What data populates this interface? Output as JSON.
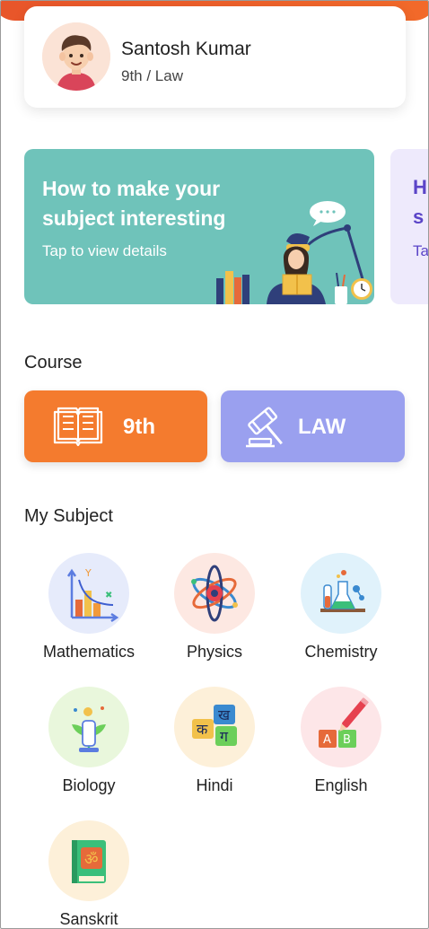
{
  "profile": {
    "name": "Santosh Kumar",
    "class_stream": "9th / Law"
  },
  "banner": {
    "title": "How to make your subject interesting",
    "cta": "Tap to view details",
    "next_peek_lines": [
      "H",
      "s",
      "Ta"
    ]
  },
  "course": {
    "section_title": "Course",
    "items": [
      {
        "label": "9th",
        "icon": "book-icon",
        "color": "#f47b2e"
      },
      {
        "label": "LAW",
        "icon": "gavel-icon",
        "color": "#9aa0ef"
      }
    ]
  },
  "subjects": {
    "section_title": "My Subject",
    "items": [
      {
        "label": "Mathematics",
        "icon": "graph-icon",
        "bg": "#e6ebfb"
      },
      {
        "label": "Physics",
        "icon": "atom-icon",
        "bg": "#fde8e2"
      },
      {
        "label": "Chemistry",
        "icon": "lab-flask-icon",
        "bg": "#e0f2fb"
      },
      {
        "label": "Biology",
        "icon": "plant-microscope-icon",
        "bg": "#e9f7dc"
      },
      {
        "label": "Hindi",
        "icon": "hindi-letters-icon",
        "bg": "#fdf0d9"
      },
      {
        "label": "English",
        "icon": "abc-blocks-icon",
        "bg": "#fde6e8"
      },
      {
        "label": "Sanskrit",
        "icon": "om-book-icon",
        "bg": "#fdf0d9"
      }
    ]
  }
}
